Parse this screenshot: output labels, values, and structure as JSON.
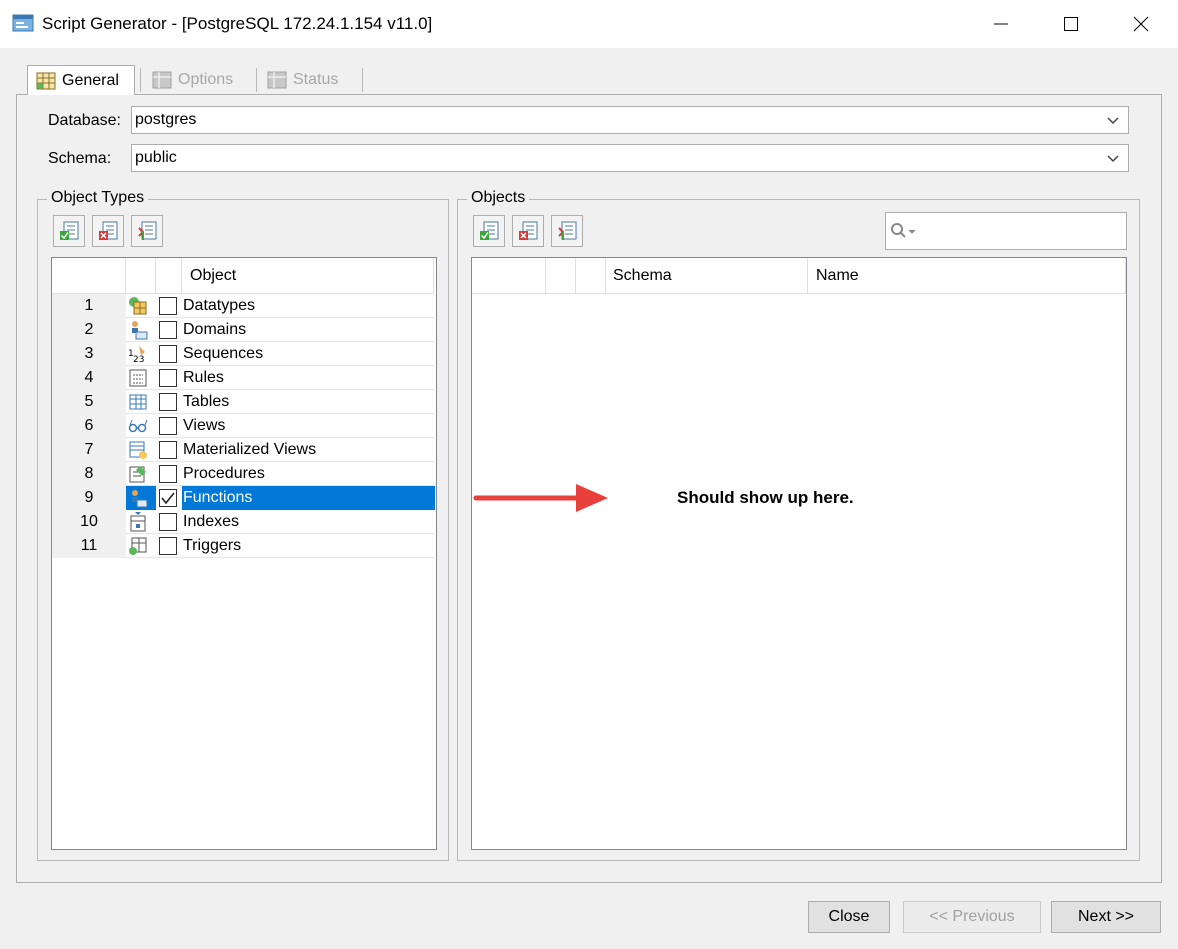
{
  "window": {
    "title": "Script Generator - [PostgreSQL 172.24.1.154 v11.0]",
    "controls": [
      "minimize-icon",
      "maximize-icon",
      "close-icon"
    ]
  },
  "tabs": [
    {
      "label": "General",
      "active": true
    },
    {
      "label": "Options",
      "active": false
    },
    {
      "label": "Status",
      "active": false
    }
  ],
  "general": {
    "database_label": "Database:",
    "database_value": "postgres",
    "schema_label": "Schema:",
    "schema_value": "public"
  },
  "object_types": {
    "title": "Object Types",
    "column_header": "Object",
    "rows": [
      {
        "num": "1",
        "label": "Datatypes",
        "icon": "datatype-icon",
        "checked": false
      },
      {
        "num": "2",
        "label": "Domains",
        "icon": "domain-icon",
        "checked": false
      },
      {
        "num": "3",
        "label": "Sequences",
        "icon": "sequence-icon",
        "checked": false
      },
      {
        "num": "4",
        "label": "Rules",
        "icon": "rule-icon",
        "checked": false
      },
      {
        "num": "5",
        "label": "Tables",
        "icon": "table-icon",
        "checked": false
      },
      {
        "num": "6",
        "label": "Views",
        "icon": "view-icon",
        "checked": false
      },
      {
        "num": "7",
        "label": "Materialized Views",
        "icon": "materialized-view-icon",
        "checked": false
      },
      {
        "num": "8",
        "label": "Procedures",
        "icon": "procedure-icon",
        "checked": false
      },
      {
        "num": "9",
        "label": "Functions",
        "icon": "function-icon",
        "checked": true,
        "selected": true
      },
      {
        "num": "10",
        "label": "Indexes",
        "icon": "index-icon",
        "checked": false
      },
      {
        "num": "11",
        "label": "Triggers",
        "icon": "trigger-icon",
        "checked": false
      }
    ]
  },
  "objects": {
    "title": "Objects",
    "columns": [
      "Schema",
      "Name"
    ],
    "search_placeholder": ""
  },
  "annotation": {
    "text": "Should show up here.",
    "arrow_color": "#e8403a"
  },
  "buttons": {
    "close": "Close",
    "previous": "<< Previous",
    "next": "Next >>"
  },
  "colors": {
    "selection": "#0078d7",
    "disabled_text": "#a0a0a0"
  }
}
